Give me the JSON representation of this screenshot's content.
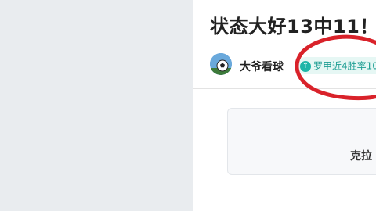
{
  "article": {
    "title": "状态大好13中11！",
    "author": "大爷看球",
    "tag": "罗甲近4胜率10",
    "card_label": "克拉"
  },
  "colors": {
    "tag_bg": "#e6f7f4",
    "tag_fg": "#1e9e93",
    "annotation": "#d9222a"
  },
  "icons": {
    "avatar": "soccer-ball-avatar",
    "tag": "up-arrow-icon"
  }
}
